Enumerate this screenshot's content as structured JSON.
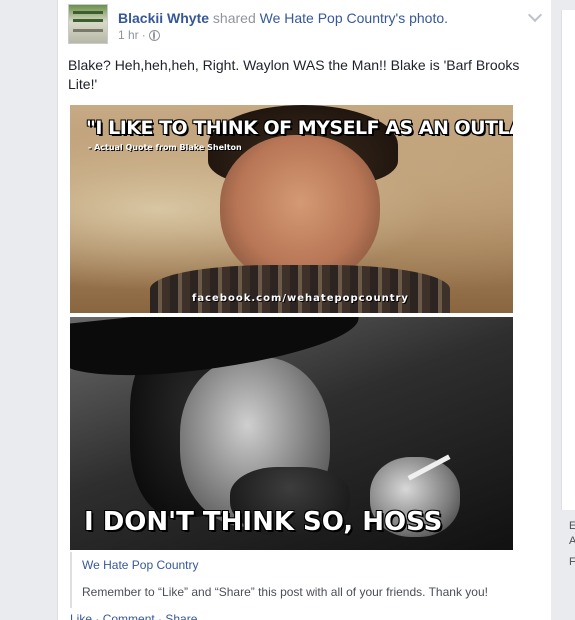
{
  "post": {
    "actor": "Blackii Whyte",
    "verb": "shared",
    "shared_from": "We Hate Pop Country's photo.",
    "timestamp": "1 hr",
    "meta_sep": "·",
    "privacy_icon": "globe-icon",
    "message": "Blake? Heh,heh,heh, Right. Waylon WAS the Man!! Blake is 'Barf Brooks Lite!'"
  },
  "photo": {
    "top_quote": "\"I LIKE TO THINK OF MYSELF AS AN OUTLAW\"",
    "top_subquote": "- Actual Quote from Blake Shelton",
    "watermark": "facebook.com/wehatepopcountry",
    "bottom_caption": "I DON'T THINK SO, HOSS"
  },
  "attachment": {
    "title": "We Hate Pop Country",
    "description": "Remember to “Like” and “Share” this post with all of your friends. Thank you!"
  },
  "actions": {
    "like": "Like",
    "comment": "Comment",
    "share": "Share",
    "sep": " · "
  },
  "sidebar_clip": {
    "a": "E",
    "b": "A",
    "c": "F"
  },
  "colors": {
    "link": "#365899",
    "muted": "#90949c",
    "background": "#e9ebee"
  }
}
